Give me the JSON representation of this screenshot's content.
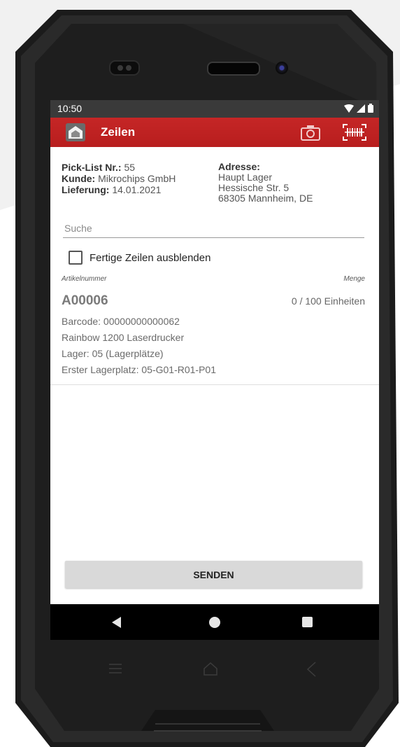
{
  "status_bar": {
    "time": "10:50",
    "icons": [
      "wifi-icon",
      "signal-icon",
      "battery-icon"
    ]
  },
  "app_bar": {
    "title": "Zeilen",
    "color": "#c42525",
    "actions": [
      "camera-icon",
      "barcode-scanner-icon"
    ]
  },
  "order": {
    "picklist_label": "Pick-List Nr.:",
    "picklist_value": "55",
    "customer_label": "Kunde:",
    "customer_value": "Mikrochips GmbH",
    "delivery_label": "Lieferung:",
    "delivery_value": "14.01.2021",
    "address_label": "Adresse:",
    "address_lines": [
      "Haupt Lager",
      "Hessische Str. 5",
      "68305 Mannheim, DE"
    ]
  },
  "search": {
    "placeholder": "Suche",
    "value": ""
  },
  "filter": {
    "hide_finished_label": "Fertige Zeilen ausblenden",
    "checked": false
  },
  "list": {
    "col_article": "Artikelnummer",
    "col_quantity": "Menge",
    "items": [
      {
        "article": "A00006",
        "quantity": "0 / 100 Einheiten",
        "barcode": "Barcode: 00000000000062",
        "description": "Rainbow 1200 Laserdrucker",
        "storage": "Lager: 05 (Lagerplätze)",
        "first_location": "Erster Lagerplatz: 05-G01-R01-P01"
      }
    ]
  },
  "send_button": "SENDEN",
  "nav_bar": [
    "back-icon",
    "home-icon",
    "recent-apps-icon"
  ]
}
